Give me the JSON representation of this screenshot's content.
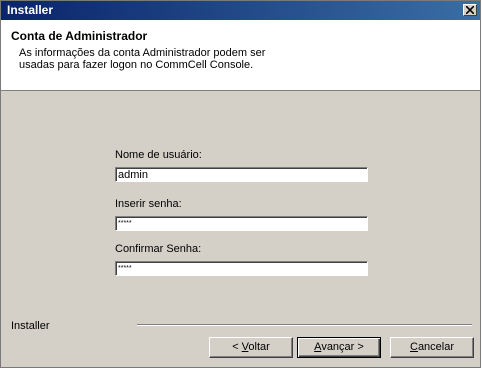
{
  "window": {
    "title": "Installer",
    "close_icon": "close-icon"
  },
  "header": {
    "title": "Conta de Administrador",
    "description_line1": "As informações da conta Administrador podem ser",
    "description_line2": "usadas para fazer logon no CommCell Console."
  },
  "form": {
    "username_label": "Nome de usuário:",
    "username_value": "admin",
    "password_label": "Inserir senha:",
    "password_value": "*****",
    "confirm_label": "Confirmar Senha:",
    "confirm_value": "*****"
  },
  "footer": {
    "label": "Installer",
    "back": {
      "prefix": "< ",
      "accel": "V",
      "rest": "oltar"
    },
    "next": {
      "accel": "A",
      "rest": "vançar",
      "suffix": " >"
    },
    "cancel": {
      "accel": "C",
      "rest": "ancelar"
    }
  }
}
